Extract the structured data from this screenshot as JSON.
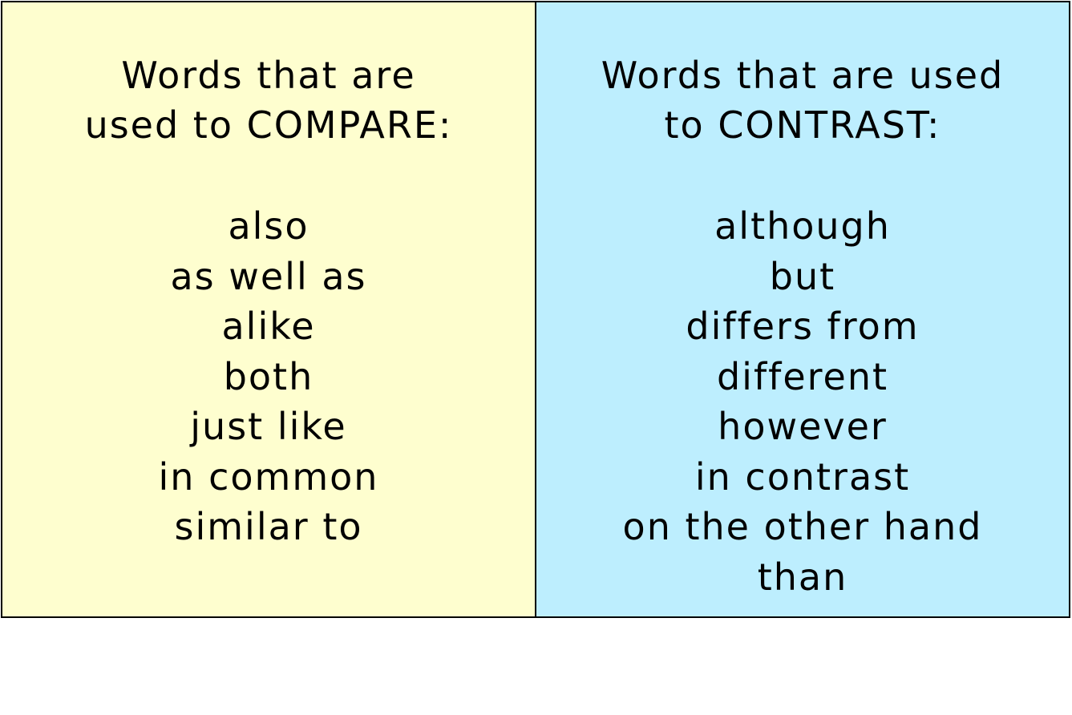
{
  "colors": {
    "compare_background": "#fefecf",
    "contrast_background": "#bdeefe",
    "border": "#000000",
    "text": "#000000"
  },
  "compare": {
    "heading_line1": "Words that are",
    "heading_line2": "used to COMPARE:",
    "words": [
      "also",
      "as well as",
      "alike",
      "both",
      "just like",
      "in common",
      "similar to"
    ]
  },
  "contrast": {
    "heading_line1": "Words that are used",
    "heading_line2": "to CONTRAST:",
    "words": [
      "although",
      "but",
      "differs from",
      "different",
      "however",
      "in contrast",
      "on the other hand",
      "than"
    ]
  }
}
